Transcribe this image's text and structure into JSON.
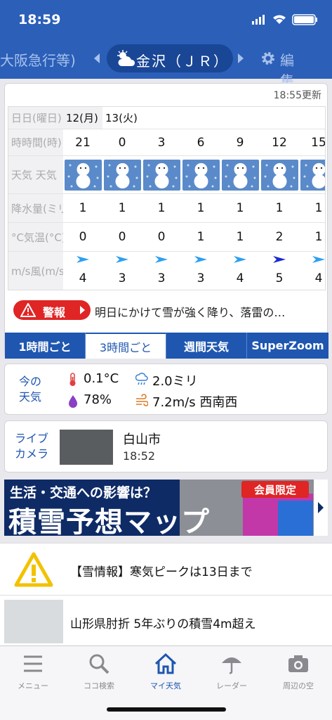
{
  "status_bar": {
    "time": "18:59"
  },
  "header": {
    "prev_location": "大阪急行等)",
    "location": "金沢（ＪＲ）",
    "edit_label": "編集"
  },
  "forecast": {
    "updated": "18:55更新",
    "row_labels": {
      "date": "日日(曜日)",
      "time": "時時間(時)",
      "weather": "天気 天気",
      "precip": "降水量(ミリ)",
      "temp": "°C気温(°C)",
      "wind": "m/s風(m/s)"
    },
    "dates": [
      "12(月)",
      "13(火)"
    ],
    "times": [
      "21",
      "0",
      "3",
      "6",
      "9",
      "12",
      "15"
    ],
    "weather": [
      "snow",
      "snow",
      "snow",
      "snow",
      "snow",
      "snow",
      "snow"
    ],
    "precip": [
      "1",
      "1",
      "1",
      "1",
      "1",
      "1",
      "1"
    ],
    "temp": [
      "0",
      "0",
      "0",
      "1",
      "1",
      "2",
      "1"
    ],
    "wind_speed": [
      "4",
      "3",
      "3",
      "3",
      "4",
      "5",
      "4"
    ],
    "wind_direction": "WSW"
  },
  "warning": {
    "badge": "警報",
    "text": "明日にかけて雪が強く降り、落雷の…"
  },
  "tabs": [
    "1時間ごと",
    "3時間ごと",
    "週間天気",
    "SuperZoom"
  ],
  "active_tab": "3時間ごと",
  "now": {
    "label_line1": "今の",
    "label_line2": "天気",
    "temp": "0.1°C",
    "precip": "2.0ミリ",
    "humidity": "78%",
    "wind": "7.2m/s 西南西"
  },
  "camera": {
    "label_line1": "ライブ",
    "label_line2": "カメラ",
    "city": "白山市",
    "time": "18:52"
  },
  "banner": {
    "line1": "生活・交通への影響は？",
    "line2": "積雪予想マップ",
    "badge": "会員限定"
  },
  "news": [
    {
      "title": "【雪情報】寒気ピークは13日まで"
    },
    {
      "title": "山形県肘折 5年ぶりの積雪4m超え"
    }
  ],
  "tabbar": [
    "メニュー",
    "ココ検索",
    "マイ天気",
    "レーダー",
    "周辺の空"
  ],
  "colors": {
    "primary": "#2b5fb8",
    "warning": "#e02525",
    "weather_cell": "#5a8ac9",
    "active_tab": "#1f56b0"
  }
}
